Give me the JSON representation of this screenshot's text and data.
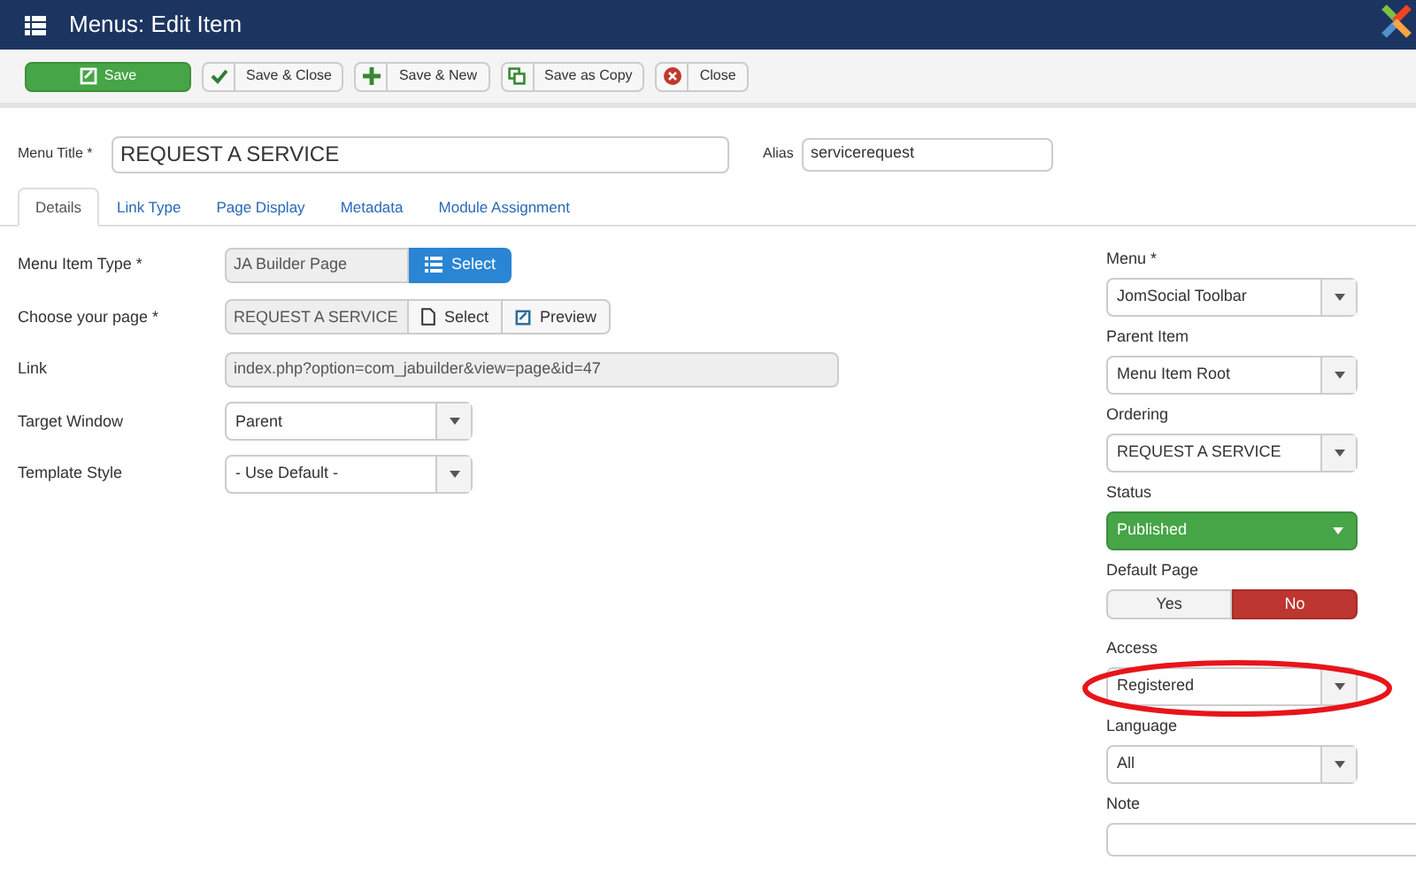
{
  "header": {
    "title": "Menus: Edit Item"
  },
  "toolbar": [
    {
      "label": "Save",
      "kind": "primary"
    },
    {
      "label": "Save & Close",
      "kind": "default"
    },
    {
      "label": "Save & New",
      "kind": "default"
    },
    {
      "label": "Save as Copy",
      "kind": "default"
    },
    {
      "label": "Close",
      "kind": "default"
    }
  ],
  "title_field": {
    "label": "Menu Title *",
    "value": "REQUEST A SERVICE"
  },
  "alias_field": {
    "label": "Alias",
    "value": "servicerequest"
  },
  "tabs": [
    {
      "label": "Details",
      "selected": true
    },
    {
      "label": "Link Type",
      "selected": false
    },
    {
      "label": "Page Display",
      "selected": false
    },
    {
      "label": "Metadata",
      "selected": false
    },
    {
      "label": "Module Assignment",
      "selected": false
    }
  ],
  "details": [
    {
      "kind": "type-select",
      "label": "Menu Item Type *",
      "value": "JA Builder Page",
      "button": "Select"
    },
    {
      "kind": "page-picker",
      "label": "Choose your page *",
      "value": "REQUEST A SERVICE",
      "buttons": [
        "Select",
        "Preview"
      ]
    },
    {
      "kind": "readonly",
      "label": "Link",
      "value": "index.php?option=com_jabuilder&view=page&id=47"
    },
    {
      "kind": "dropdown",
      "label": "Target Window",
      "value": "Parent"
    },
    {
      "kind": "dropdown",
      "label": "Template Style",
      "value": "- Use Default -"
    }
  ],
  "side": [
    {
      "kind": "dropdown",
      "label": "Menu *",
      "value": "JomSocial Toolbar",
      "highlighted": false
    },
    {
      "kind": "dropdown",
      "label": "Parent Item",
      "value": "Menu Item Root",
      "highlighted": false
    },
    {
      "kind": "dropdown",
      "label": "Ordering",
      "value": "REQUEST A SERVICE",
      "highlighted": false
    },
    {
      "kind": "status",
      "label": "Status",
      "value": "Published",
      "highlighted": false
    },
    {
      "kind": "toggle",
      "label": "Default Page",
      "options": [
        {
          "label": "Yes",
          "selected": false
        },
        {
          "label": "No",
          "selected": true
        }
      ],
      "highlighted": false
    },
    {
      "kind": "dropdown",
      "label": "Access",
      "value": "Registered",
      "highlighted": true
    },
    {
      "kind": "dropdown",
      "label": "Language",
      "value": "All",
      "highlighted": false
    },
    {
      "kind": "text",
      "label": "Note",
      "highlighted": false
    }
  ]
}
